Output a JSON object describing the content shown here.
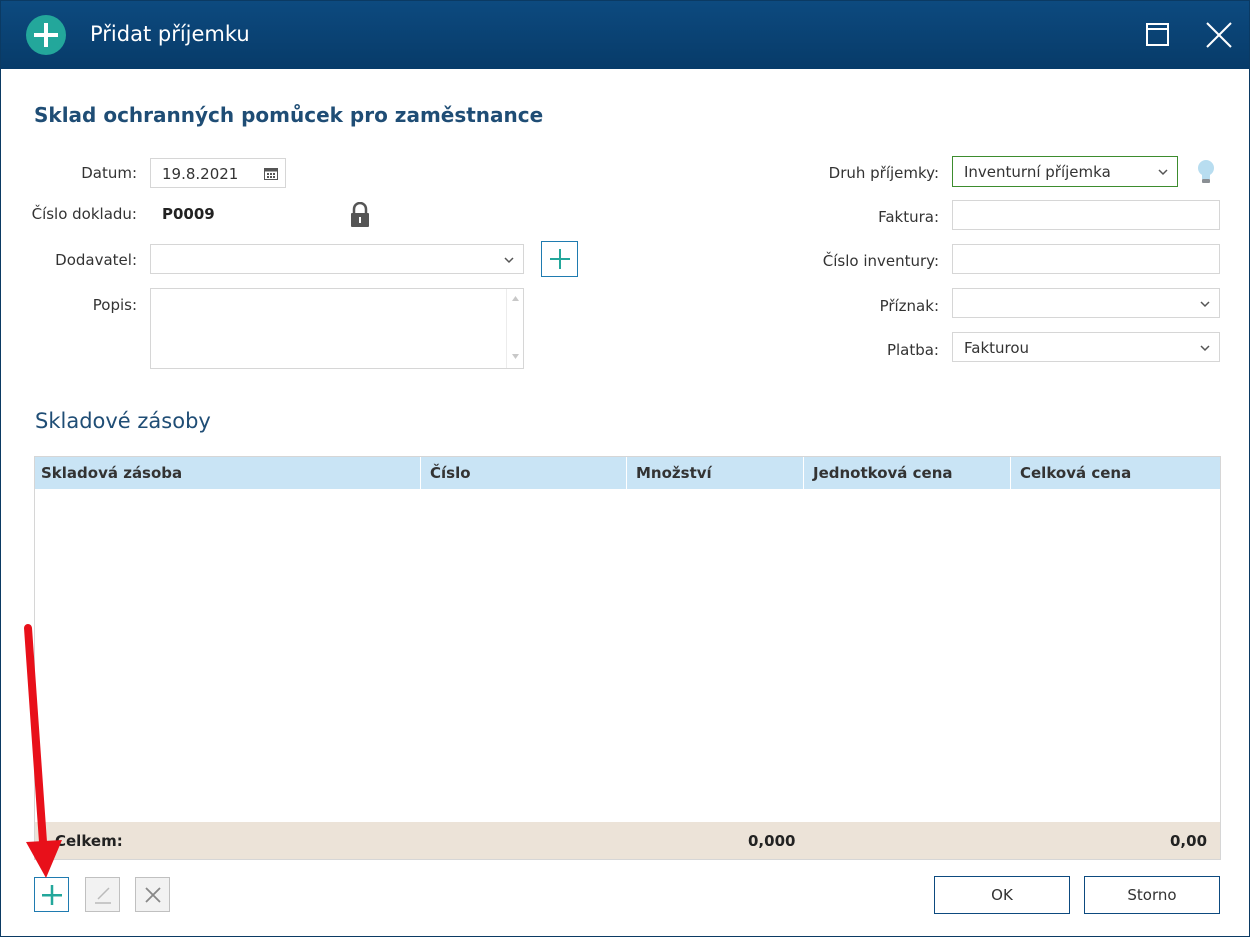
{
  "window": {
    "title": "Přidat příjemku"
  },
  "form": {
    "heading": "Sklad ochranných pomůcek pro zaměstnance",
    "date_label": "Datum:",
    "date_value": "19.8.2021",
    "doc_number_label": "Číslo dokladu:",
    "doc_number_value": "P0009",
    "supplier_label": "Dodavatel:",
    "supplier_value": "",
    "description_label": "Popis:",
    "receipt_type_label": "Druh příjemky:",
    "receipt_type_value": "Inventurní příjemka",
    "invoice_label": "Faktura:",
    "invoice_value": "",
    "inventory_number_label": "Číslo inventury:",
    "inventory_number_value": "",
    "flag_label": "Příznak:",
    "flag_value": "",
    "payment_label": "Platba:",
    "payment_value": "Fakturou"
  },
  "stock": {
    "title": "Skladové zásoby",
    "columns": [
      "Skladová zásoba",
      "Číslo",
      "Množství",
      "Jednotková cena",
      "Celková cena"
    ],
    "rows": [],
    "total_label": "Celkem:",
    "total_quantity": "0,000",
    "total_price": "0,00"
  },
  "buttons": {
    "ok": "OK",
    "cancel": "Storno"
  },
  "colors": {
    "titlebar": "#0d4a7f",
    "accent_green": "#23a79b",
    "header_blue": "#c9e4f5",
    "footer_beige": "#ece3d8",
    "annotation_arrow": "#e8101a"
  }
}
